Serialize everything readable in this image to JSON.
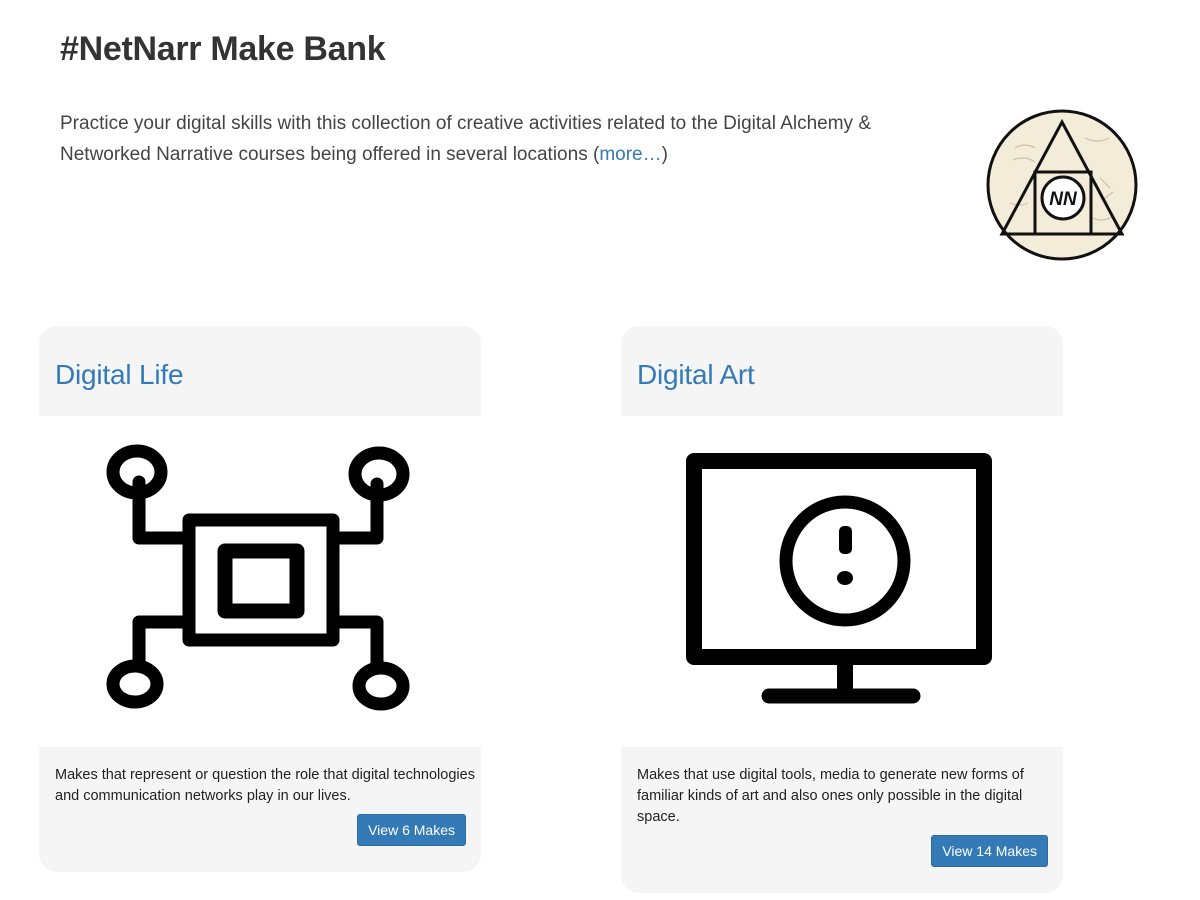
{
  "header": {
    "title": "#NetNarr Make Bank",
    "intro_text": "Practice your digital skills with this collection of creative activities related to the Digital Alchemy & Networked Narrative courses being offered in several locations (",
    "more_link": "more…",
    "intro_close": ")"
  },
  "logo": {
    "text": "NN"
  },
  "cards": [
    {
      "title": "Digital Life",
      "icon": "network-chip-icon",
      "description": "Makes that represent or question the role that digital technologies and communication networks play in our lives.",
      "button_label": "View 6 Makes"
    },
    {
      "title": "Digital Art",
      "icon": "monitor-icon",
      "description": "Makes that use digital tools, media to generate new forms of familiar kinds of art and also ones only possible in the digital space.",
      "button_label": "View 14 Makes"
    }
  ],
  "colors": {
    "accent": "#337ab7",
    "card_background": "#f5f5f5",
    "logo_background": "#f3ecd8"
  }
}
